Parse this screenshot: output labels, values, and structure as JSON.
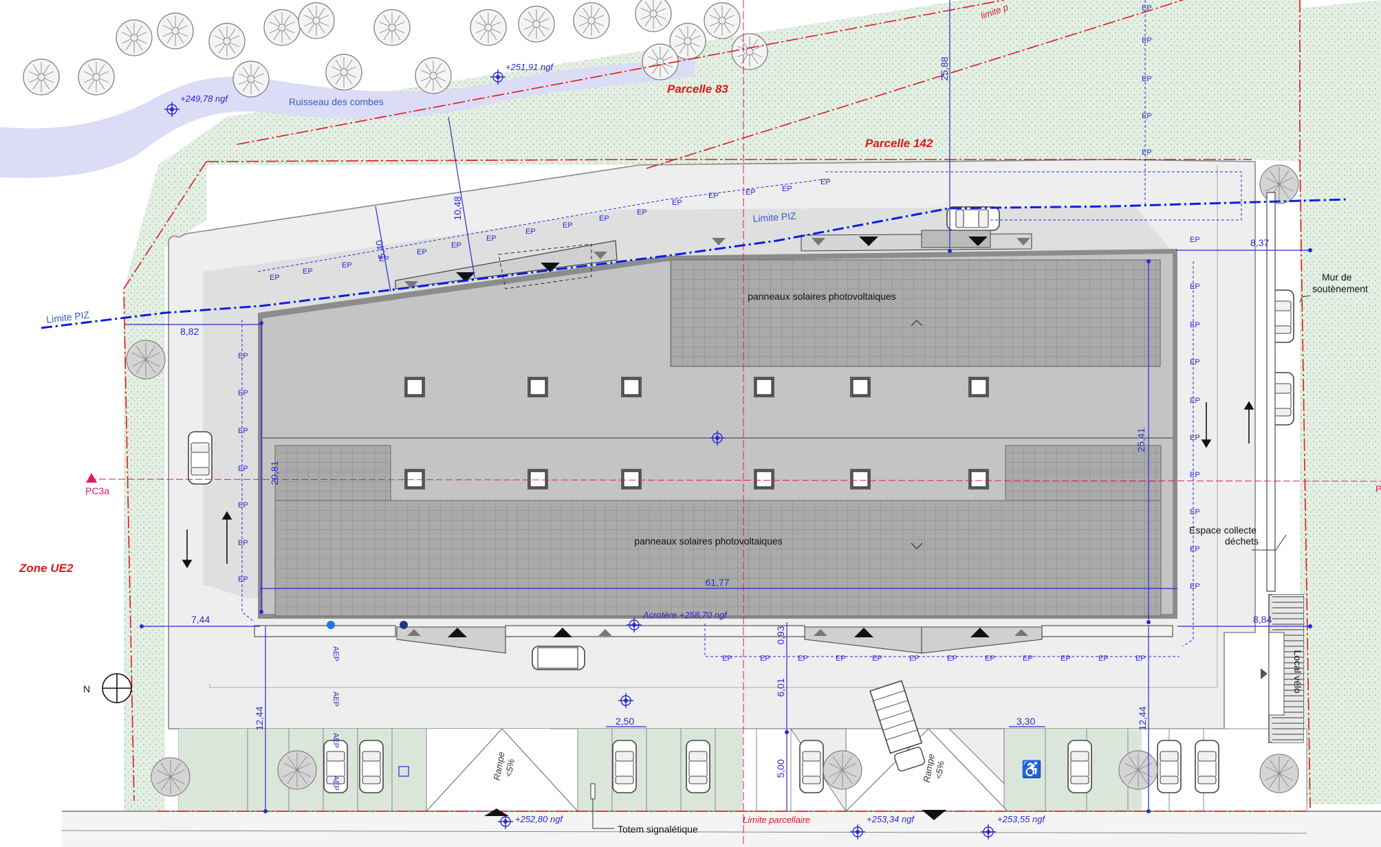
{
  "labels": {
    "ruisseau": "Ruisseau des combes",
    "parcelle_83": "Parcelle 83",
    "parcelle_142": "Parcelle 142",
    "limite_top": "limite p",
    "limite_piz": "Limite PIZ",
    "zone": "Zone UE2",
    "pc3a_left": "PC3a",
    "panneaux": "panneaux solaires photovoltaiques",
    "mur_1": "Mur de",
    "mur_2": "soutènement",
    "espace_1": "Espace collecte",
    "espace_2": "déchets",
    "local_velo": "Local vélo",
    "rampe_1": "Rampe",
    "rampe_2": "<5%",
    "totem": "Totem signalétique",
    "limite_parcellaire": "Limite parcellaire",
    "acrotere": "Acrotère +258,70 ngf",
    "ep": "EP",
    "aep": "AEP",
    "north": "N"
  },
  "levels": {
    "l1": "+249,78 ngf",
    "l2": "+251,91 ngf",
    "l3": "+252,80 ngf",
    "l4": "+253,34 ngf",
    "l5": "+253,55 ngf"
  },
  "dimensions": {
    "d25_88": "25,88",
    "d10_48": "10,48",
    "d5_40": "5,40",
    "d8_82": "8,82",
    "d8_37": "8,37",
    "d20_81": "20,81",
    "d25_41": "25,41",
    "d61_77": "61,77",
    "d7_44": "7,44",
    "d8_84": "8,84",
    "d0_93": "0,93",
    "d6_01": "6,01",
    "d5_00": "5,00",
    "d2_50": "2,50",
    "d3_30": "3,30",
    "d12_44_l": "12,44",
    "d12_44_r": "12,44"
  },
  "colors": {
    "dimension_blue": "#2a2ad0",
    "limit_red": "#e01818",
    "piz_blue": "#0a1ee0",
    "green_area": "#e3eee3",
    "water": "#dcdcf6",
    "roof": "#c4c4c4",
    "solar": "#a8a8a8",
    "magenta": "#e0186e"
  }
}
